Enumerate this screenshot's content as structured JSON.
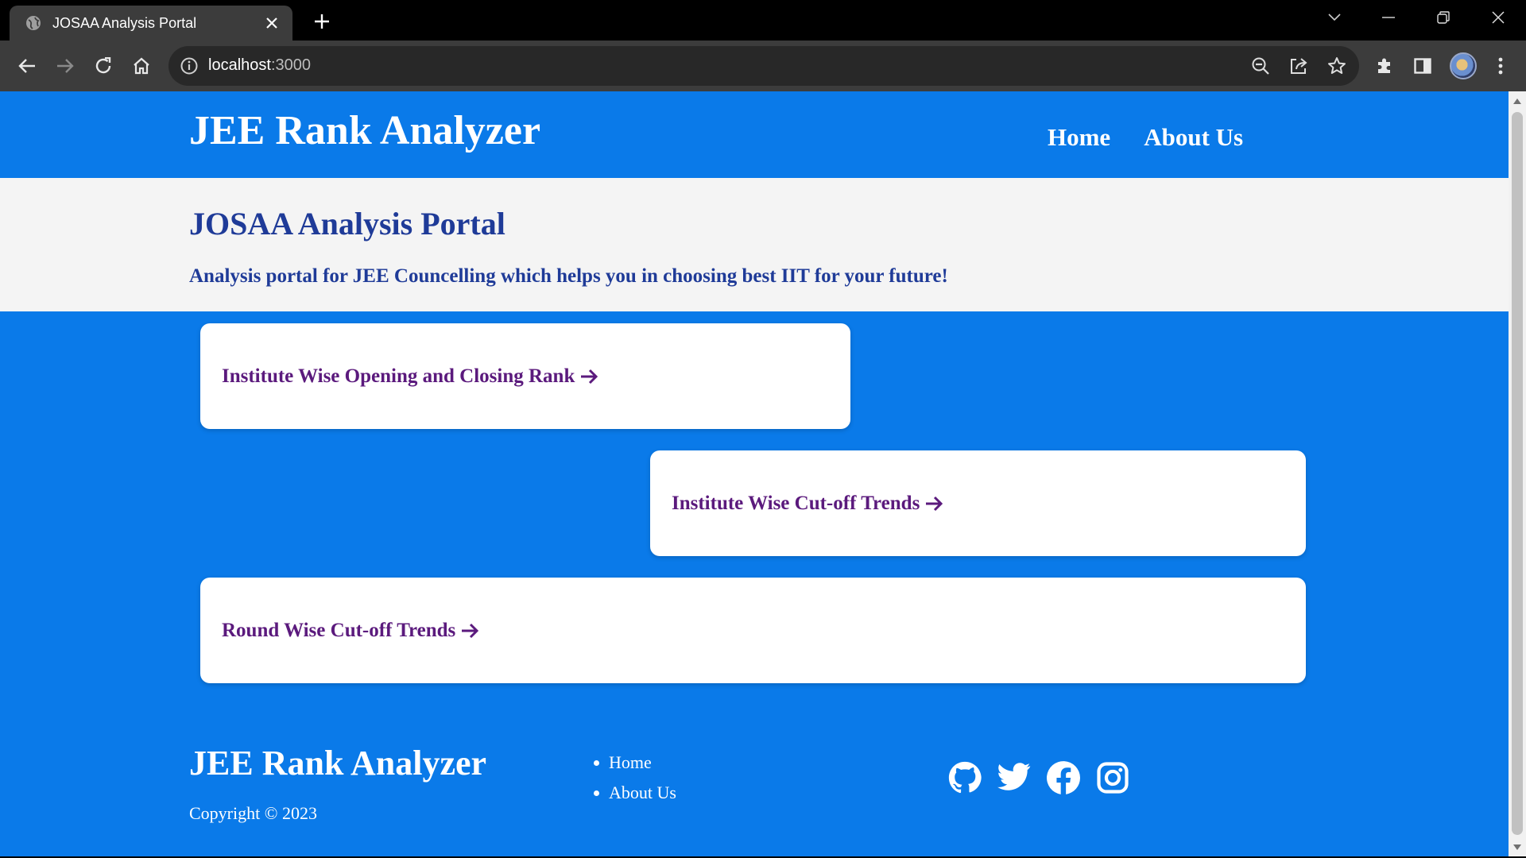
{
  "browser": {
    "tab_title": "JOSAA Analysis Portal",
    "url_host": "localhost",
    "url_port": ":3000"
  },
  "navbar": {
    "brand": "JEE Rank Analyzer",
    "links": [
      "Home",
      "About Us"
    ]
  },
  "hero": {
    "title": "JOSAA Analysis Portal",
    "subtitle": "Analysis portal for JEE Councelling which helps you in choosing best IIT for your future!"
  },
  "cards": [
    {
      "label": "Institute Wise Opening and Closing Rank"
    },
    {
      "label": "Institute Wise Cut-off Trends"
    },
    {
      "label": "Round Wise Cut-off Trends"
    }
  ],
  "footer": {
    "brand": "JEE Rank Analyzer",
    "copyright": "Copyright © 2023",
    "links": [
      "Home",
      "About Us"
    ],
    "socials": [
      "github-icon",
      "twitter-icon",
      "facebook-icon",
      "instagram-icon"
    ]
  },
  "colors": {
    "primary": "#0a7ae9",
    "hero_bg": "#f4f4f4",
    "hero_text": "#1f3b98",
    "card_link": "#5b1a7d"
  }
}
